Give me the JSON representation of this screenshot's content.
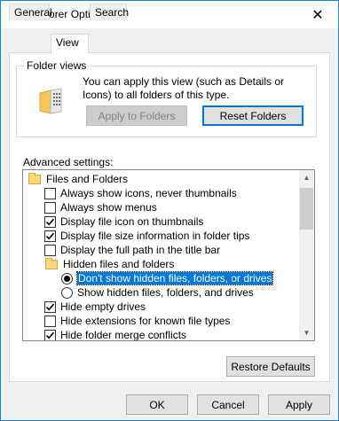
{
  "window": {
    "title": "File Explorer Options"
  },
  "tabs": [
    {
      "label": "General"
    },
    {
      "label": "View"
    },
    {
      "label": "Search"
    }
  ],
  "folder_views": {
    "legend": "Folder views",
    "description": "You can apply this view (such as Details or Icons) to all folders of this type.",
    "apply_button": "Apply to Folders",
    "reset_button": "Reset Folders"
  },
  "advanced": {
    "label": "Advanced settings:",
    "items": [
      {
        "type": "folder",
        "label": "Files and Folders"
      },
      {
        "type": "checkbox",
        "checked": false,
        "label": "Always show icons, never thumbnails"
      },
      {
        "type": "checkbox",
        "checked": false,
        "label": "Always show menus"
      },
      {
        "type": "checkbox",
        "checked": true,
        "label": "Display file icon on thumbnails"
      },
      {
        "type": "checkbox",
        "checked": true,
        "label": "Display file size information in folder tips"
      },
      {
        "type": "checkbox",
        "checked": false,
        "label": "Display the full path in the title bar"
      },
      {
        "type": "folder",
        "label": "Hidden files and folders"
      },
      {
        "type": "radio",
        "checked": true,
        "label": "Don't show hidden files, folders, or drives"
      },
      {
        "type": "radio",
        "checked": false,
        "label": "Show hidden files, folders, and drives"
      },
      {
        "type": "checkbox",
        "checked": true,
        "label": "Hide empty drives"
      },
      {
        "type": "checkbox",
        "checked": false,
        "label": "Hide extensions for known file types"
      },
      {
        "type": "checkbox",
        "checked": true,
        "label": "Hide folder merge conflicts"
      }
    ]
  },
  "restore_defaults": "Restore Defaults",
  "footer": {
    "ok": "OK",
    "cancel": "Cancel",
    "apply": "Apply"
  }
}
